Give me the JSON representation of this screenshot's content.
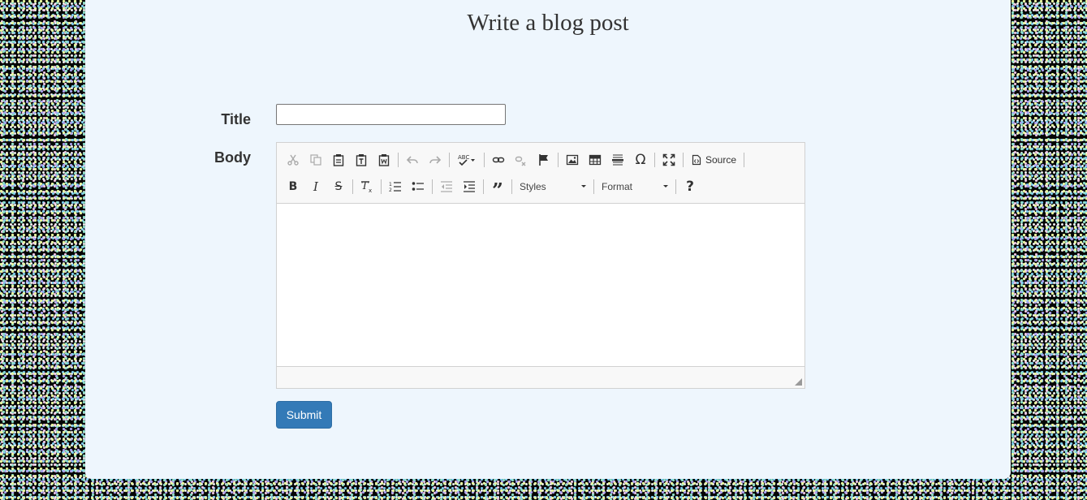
{
  "page": {
    "title": "Write a blog post"
  },
  "form": {
    "title_label": "Title",
    "title_value": "",
    "body_label": "Body",
    "submit_label": "Submit"
  },
  "editor": {
    "source_label": "Source",
    "styles_label": "Styles",
    "format_label": "Format",
    "help_label": "?",
    "content": ""
  },
  "icons": {
    "row1": [
      "cut-icon",
      "copy-icon",
      "paste-icon",
      "paste-text-icon",
      "paste-word-icon",
      "undo-icon",
      "redo-icon",
      "spellcheck-icon",
      "link-icon",
      "unlink-icon",
      "anchor-icon",
      "image-icon",
      "table-icon",
      "horizontal-line-icon",
      "special-char-icon",
      "maximize-icon",
      "source-icon"
    ],
    "row2": [
      "bold-icon",
      "italic-icon",
      "strikethrough-icon",
      "remove-format-icon",
      "numbered-list-icon",
      "bulleted-list-icon",
      "outdent-icon",
      "indent-icon",
      "blockquote-icon",
      "help-icon"
    ]
  },
  "colors": {
    "panel": "#eef6fd",
    "submit": "#337ab7"
  }
}
